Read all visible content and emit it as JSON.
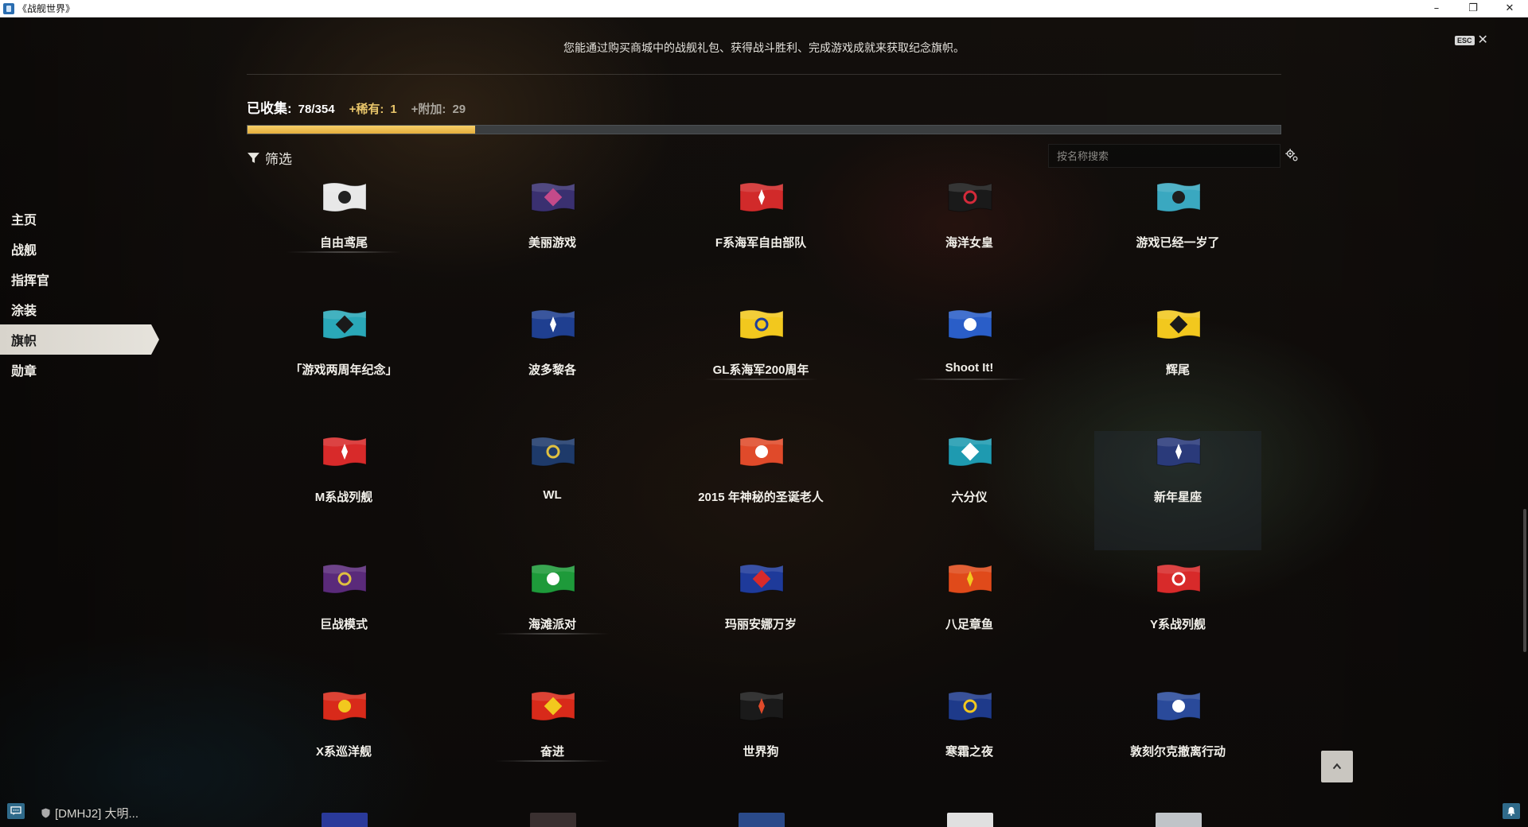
{
  "window": {
    "title": "《战舰世界》",
    "minimize": "–",
    "restore": "❐",
    "close": "✕"
  },
  "header": {
    "info": "您能通过购买商城中的战舰礼包、获得战斗胜利、完成游戏成就来获取纪念旗帜。",
    "esc": "ESC",
    "close": "✕"
  },
  "collection": {
    "label": "已收集:",
    "count": "78/354",
    "rare_label": "+稀有:",
    "rare_value": "1",
    "extra_label": "+附加:",
    "extra_value": "29",
    "progress_fraction": 0.22,
    "progress_color": "#f0c050"
  },
  "filter": {
    "label": "筛选"
  },
  "search": {
    "placeholder": "按名称搜索"
  },
  "nav": {
    "items": [
      {
        "label": "主页",
        "active": false
      },
      {
        "label": "战舰",
        "active": false
      },
      {
        "label": "指挥官",
        "active": false
      },
      {
        "label": "涂装",
        "active": false
      },
      {
        "label": "旗帜",
        "active": true
      },
      {
        "label": "勋章",
        "active": false
      }
    ]
  },
  "flags": [
    {
      "label": "自由鸢尾",
      "icon": "fleur-de-lis-flag-icon",
      "colors": [
        "#e8e8e8",
        "#222222"
      ]
    },
    {
      "label": "美丽游戏",
      "icon": "hexagon-pattern-flag-icon",
      "colors": [
        "#3a3070",
        "#c44a8a"
      ]
    },
    {
      "label": "F系海军自由部队",
      "icon": "free-french-cross-flag-icon",
      "colors": [
        "#d12a2a",
        "#ffffff"
      ]
    },
    {
      "label": "海洋女皇",
      "icon": "heart-crown-flag-icon",
      "colors": [
        "#1a1a1a",
        "#d42a3a"
      ]
    },
    {
      "label": "游戏已经一岁了",
      "icon": "anniversary-shield-flag-icon",
      "colors": [
        "#3aa8c0",
        "#1e1e1e"
      ]
    },
    {
      "label": "「游戏两周年纪念」",
      "icon": "anniversary-emblem-flag-icon",
      "colors": [
        "#2aa8b8",
        "#1a1a1a"
      ]
    },
    {
      "label": "波多黎各",
      "icon": "puerto-rico-flag-icon",
      "colors": [
        "#1f3f90",
        "#ffffff"
      ]
    },
    {
      "label": "GL系海军200周年",
      "icon": "gran-colombia-flag-icon",
      "colors": [
        "#f2c81e",
        "#1e3e9a"
      ]
    },
    {
      "label": "Shoot It!",
      "icon": "shoot-it-cartoon-flag-icon",
      "colors": [
        "#2a5ec8",
        "#ffffff"
      ]
    },
    {
      "label": "辉尾",
      "icon": "hazard-stripe-flag-icon",
      "colors": [
        "#f2c81e",
        "#1a1a1a"
      ]
    },
    {
      "label": "M系战列舰",
      "icon": "bird-emblem-flag-icon",
      "colors": [
        "#d82a2a",
        "#ffffff"
      ]
    },
    {
      "label": "WL",
      "icon": "wl-crest-flag-icon",
      "colors": [
        "#1e3a6a",
        "#e0c040"
      ]
    },
    {
      "label": "2015 年神秘的圣诞老人",
      "icon": "skull-santa-flag-icon",
      "colors": [
        "#e04a2a",
        "#ffffff"
      ]
    },
    {
      "label": "六分仪",
      "icon": "sextant-flag-icon",
      "colors": [
        "#1e9ab0",
        "#ffffff"
      ]
    },
    {
      "label": "新年星座",
      "icon": "constellation-flag-icon",
      "colors": [
        "#2a3a7a",
        "#ffffff"
      ]
    },
    {
      "label": "巨战模式",
      "icon": "grid-pyramid-flag-icon",
      "colors": [
        "#5a2a7a",
        "#e0c040"
      ]
    },
    {
      "label": "海滩派对",
      "icon": "beach-cocktail-flag-icon",
      "colors": [
        "#1e9a3a",
        "#ffffff"
      ]
    },
    {
      "label": "玛丽安娜万岁",
      "icon": "rooster-flag-icon",
      "colors": [
        "#1e3a9a",
        "#d82a2a"
      ]
    },
    {
      "label": "八足章鱼",
      "icon": "octopus-diamond-flag-icon",
      "colors": [
        "#e04a1a",
        "#f2c81e"
      ]
    },
    {
      "label": "Y系战列舰",
      "icon": "red-cross-crest-flag-icon",
      "colors": [
        "#d82a2a",
        "#ffffff"
      ]
    },
    {
      "label": "X系巡洋舰",
      "icon": "anchor-crest-flag-icon",
      "colors": [
        "#d82a1a",
        "#f2c81e"
      ]
    },
    {
      "label": "奋进",
      "icon": "heraldic-flag-icon",
      "colors": [
        "#d82a1a",
        "#f2c81e"
      ]
    },
    {
      "label": "世界狗",
      "icon": "wolf-head-flag-icon",
      "colors": [
        "#1a1a1a",
        "#e04a2a"
      ]
    },
    {
      "label": "寒霜之夜",
      "icon": "compass-star-flag-icon",
      "colors": [
        "#1e3a8a",
        "#f2c81e"
      ]
    },
    {
      "label": "敦刻尔克撤离行动",
      "icon": "crossed-swords-flag-icon",
      "colors": [
        "#2a4a9a",
        "#ffffff"
      ]
    }
  ],
  "highlighted_flags": [
    "新年星座"
  ],
  "partial_row_colors": [
    "#2a3a9a",
    "#3a3030",
    "#2a4a8a",
    "#e0e0e0",
    "#c0c4c8"
  ]
}
